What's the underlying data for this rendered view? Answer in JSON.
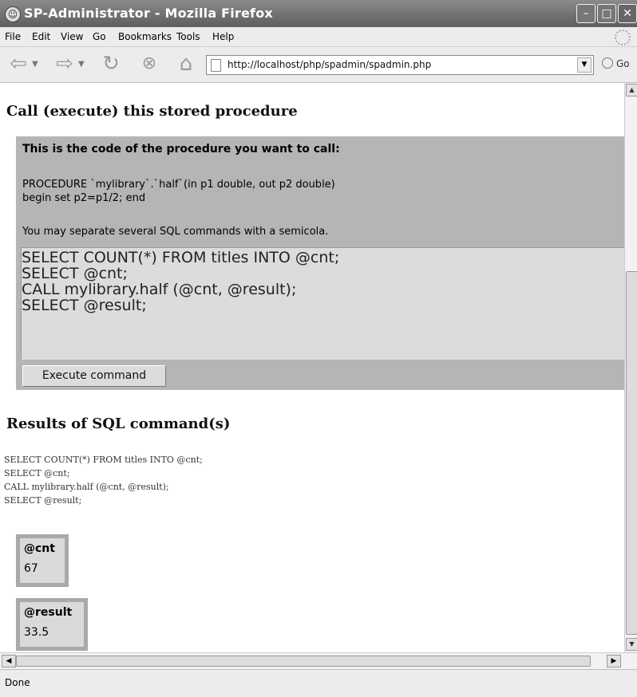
{
  "window": {
    "title": "SP-Administrator - Mozilla Firefox"
  },
  "menu": {
    "items": [
      "File",
      "Edit",
      "View",
      "Go",
      "Bookmarks",
      "Tools",
      "Help"
    ]
  },
  "nav": {
    "url": "http://localhost/php/spadmin/spadmin.php",
    "go_label": "Go"
  },
  "page": {
    "heading": "Call (execute) this stored procedure",
    "procedure_box_title": "This is the code of the procedure you want to call:",
    "procedure_code": "PROCEDURE `mylibrary`.`half`(in p1 double, out p2 double)\nbegin set p2=p1/2; end",
    "hint": "You may separate several SQL commands with a semicola.",
    "sql_text": "SELECT COUNT(*) FROM titles INTO @cnt;\nSELECT @cnt;\nCALL mylibrary.half (@cnt, @result);\nSELECT @result;",
    "execute_label": "Execute command",
    "results_heading": "Results of SQL command(s)",
    "echo_text": "SELECT COUNT(*) FROM titles INTO @cnt;\nSELECT @cnt;\nCALL mylibrary.half (@cnt, @result);\nSELECT @result;",
    "results": [
      {
        "header": "@cnt",
        "value": "67"
      },
      {
        "header": "@result",
        "value": "33.5"
      }
    ]
  },
  "status": {
    "text": "Done"
  }
}
